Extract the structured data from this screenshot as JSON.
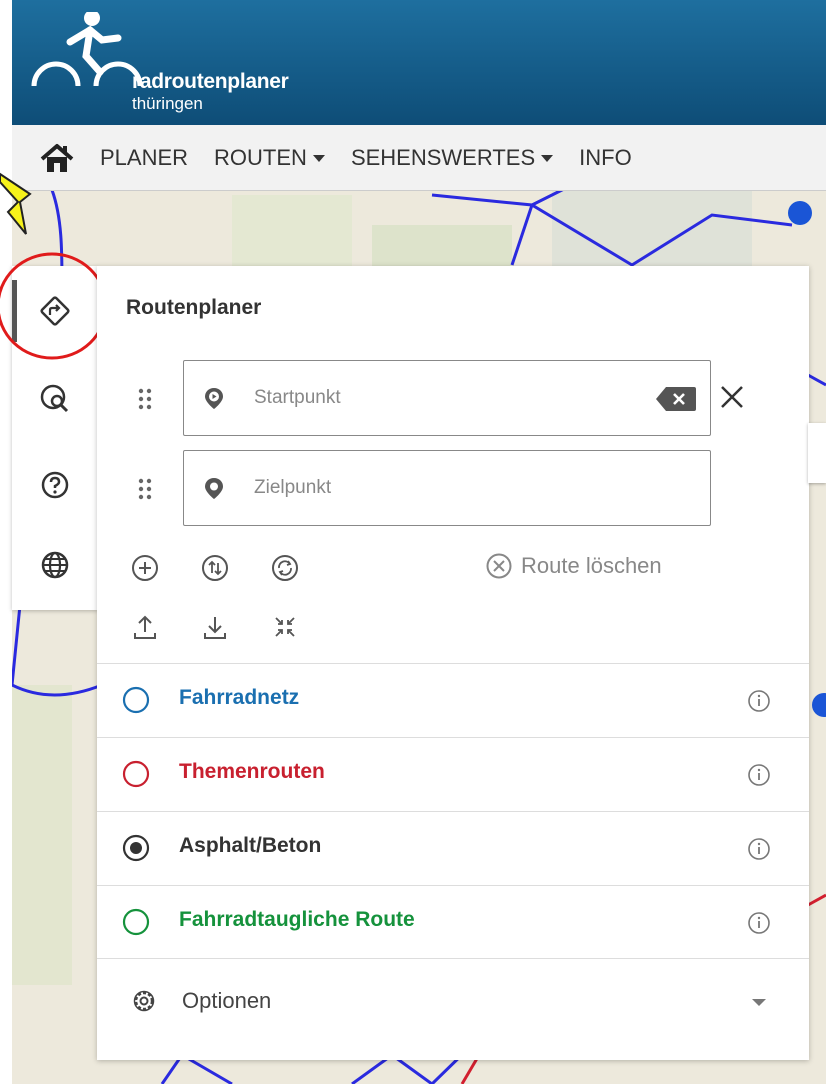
{
  "header": {
    "logo_line1": "radroutenplaner",
    "logo_line2": "thüringen",
    "brand_color": "#145f8f"
  },
  "nav": {
    "items": [
      {
        "label": "PLANER"
      },
      {
        "label": "ROUTEN"
      },
      {
        "label": "SEHENSWERTES"
      },
      {
        "label": "INFO"
      }
    ]
  },
  "toolbar": {
    "icons": [
      "route-planner-icon",
      "poi-search-icon",
      "help-icon",
      "language-icon"
    ]
  },
  "panel": {
    "title": "Routenplaner",
    "start_placeholder": "Startpunkt",
    "end_placeholder": "Zielpunkt",
    "route_delete_label": "Route löschen",
    "layers": [
      {
        "label": "Fahrradnetz",
        "color": "#1a6fb0",
        "selected": false
      },
      {
        "label": "Themenrouten",
        "color": "#c8202f",
        "selected": false
      },
      {
        "label": "Asphalt/Beton",
        "color": "#333333",
        "selected": true
      },
      {
        "label": "Fahrradtaugliche Route",
        "color": "#15923c",
        "selected": false
      }
    ],
    "options_label": "Optionen"
  }
}
